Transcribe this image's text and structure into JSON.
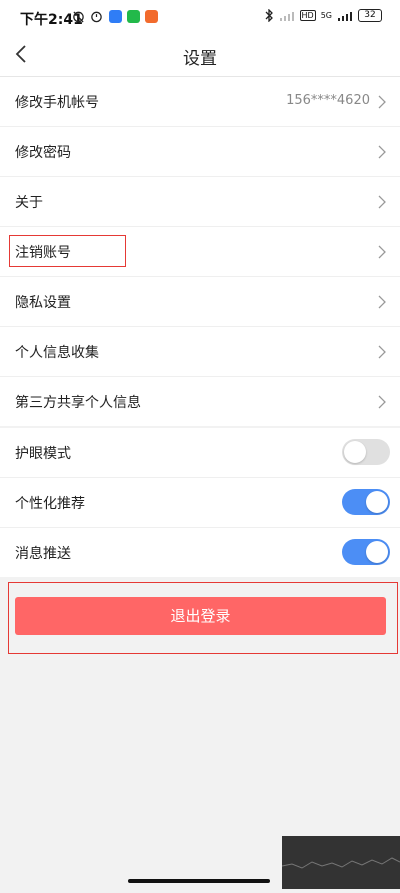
{
  "status_bar": {
    "time": "下午2:41",
    "network": "5G",
    "battery": "32"
  },
  "header": {
    "title": "设置"
  },
  "account_group": [
    {
      "label": "修改手机帐号",
      "value": "156****4620"
    },
    {
      "label": "修改密码"
    },
    {
      "label": "关于"
    },
    {
      "label": "注销账号"
    },
    {
      "label": "隐私设置"
    },
    {
      "label": "个人信息收集"
    },
    {
      "label": "第三方共享个人信息"
    }
  ],
  "toggle_group": [
    {
      "label": "护眼模式",
      "state": "off"
    },
    {
      "label": "个性化推荐",
      "state": "on"
    },
    {
      "label": "消息推送",
      "state": "on"
    }
  ],
  "logout": {
    "label": "退出登录"
  },
  "colors": {
    "accent_toggle": "#4c8ef5",
    "logout_button": "#ff6666",
    "highlight_border": "#e53935"
  }
}
